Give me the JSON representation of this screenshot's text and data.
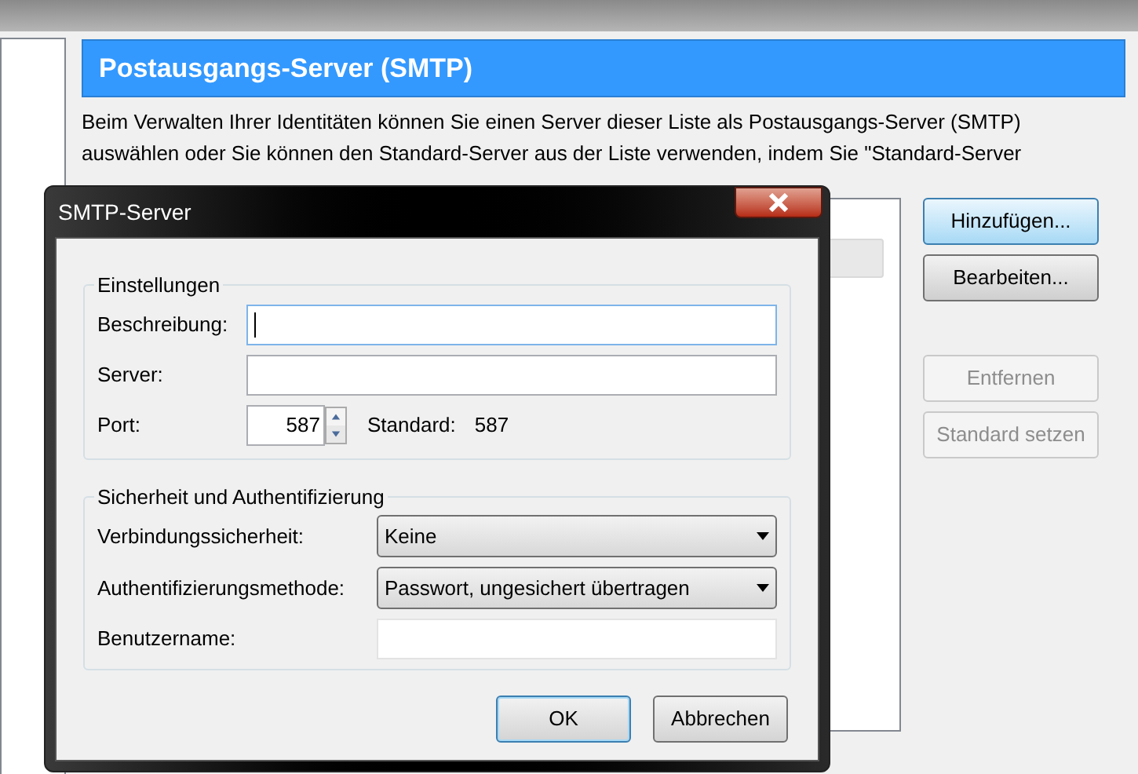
{
  "panel": {
    "title": "Postausgangs-Server (SMTP)",
    "description": "Beim Verwalten Ihrer Identitäten können Sie einen Server dieser Liste als Postausgangs-Server (SMTP) auswählen oder Sie können den Standard-Server aus der Liste verwenden, indem Sie \"Standard-Server"
  },
  "side_buttons": [
    {
      "label": "Hinzufügen...",
      "disabled": false,
      "focused": true
    },
    {
      "label": "Bearbeiten...",
      "disabled": false,
      "focused": false
    },
    {
      "label": "Entfernen",
      "disabled": true,
      "focused": false
    },
    {
      "label": "Standard setzen",
      "disabled": true,
      "focused": false
    }
  ],
  "dialog": {
    "title": "SMTP-Server",
    "settings": {
      "legend": "Einstellungen",
      "description_label": "Beschreibung:",
      "server_label": "Server:",
      "port_label": "Port:",
      "port_value": "587",
      "default_label": "Standard:",
      "default_value": "587"
    },
    "security": {
      "legend": "Sicherheit und Authentifizierung",
      "rows": [
        {
          "kind": "select",
          "label": "Verbindungssicherheit:",
          "value": "Keine"
        },
        {
          "kind": "select",
          "label": "Authentifizierungsmethode:",
          "value": "Passwort, ungesichert übertragen"
        },
        {
          "kind": "input",
          "label": "Benutzername:",
          "value": ""
        }
      ]
    },
    "buttons": [
      {
        "label": "OK",
        "default": true
      },
      {
        "label": "Abbrechen",
        "default": false
      }
    ]
  }
}
